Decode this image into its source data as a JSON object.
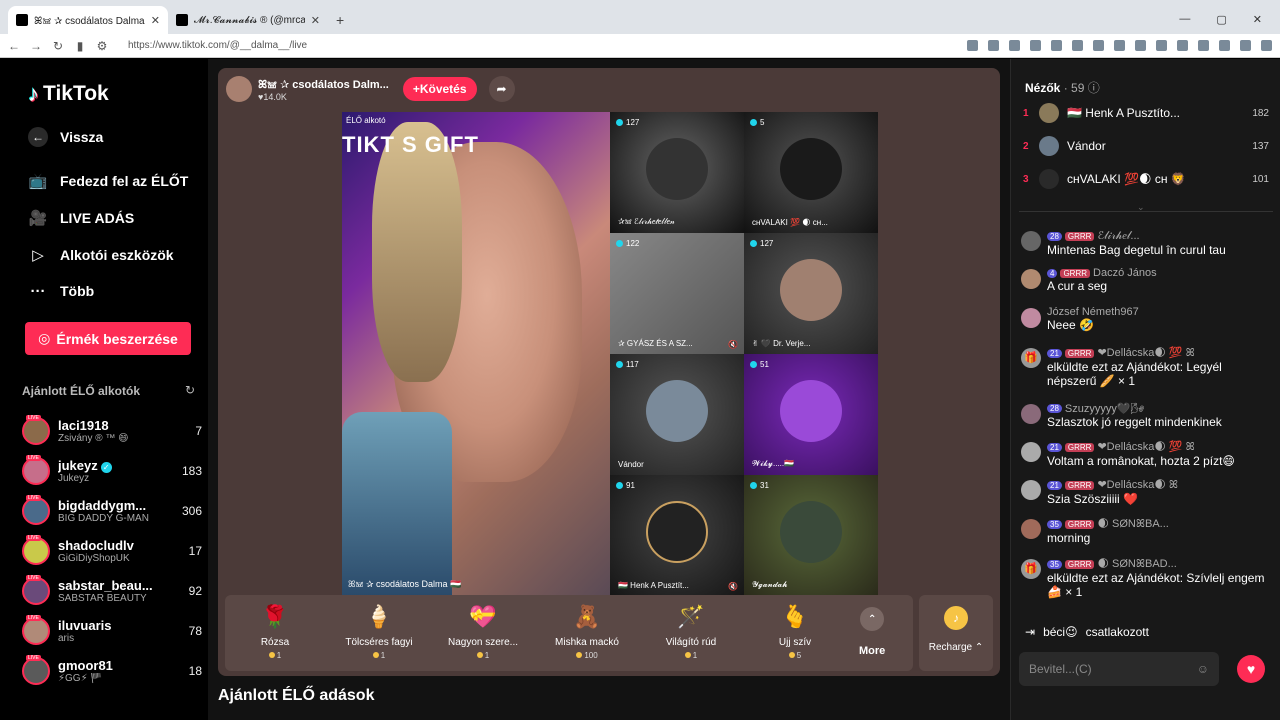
{
  "browser": {
    "tabs": [
      {
        "title": "ꕤ𖠌 ✰ csodálatos Dalma",
        "close": "✕"
      },
      {
        "title": "𝓜𝓻.𝓒𝓪𝓷𝓷𝓪𝓫𝓲𝓼 ® (@mrcannabis_)",
        "close": "✕"
      }
    ],
    "new_tab": "+",
    "url": "https://www.tiktok.com/@__dalma__/live"
  },
  "sidebar": {
    "logo": "TikTok",
    "back": "Vissza",
    "nav": [
      {
        "label": "Fedezd fel az ÉLŐT",
        "icon": "tv-icon"
      },
      {
        "label": "LIVE ADÁS",
        "icon": "camera-icon"
      },
      {
        "label": "Alkotói eszközök",
        "icon": "tools-icon"
      },
      {
        "label": "Több",
        "icon": "more-icon"
      }
    ],
    "coins_button": "Érmék beszerzése",
    "recommended_title": "Ajánlott ÉLŐ alkotók",
    "creators": [
      {
        "name": "laci1918",
        "sub": "Zsivány ® ™ 😄",
        "count": "7",
        "verified": false
      },
      {
        "name": "jukeyz",
        "sub": "Jukeyz",
        "count": "183",
        "verified": true
      },
      {
        "name": "bigdaddygm...",
        "sub": "BIG DADDY G-MAN",
        "count": "306",
        "verified": false
      },
      {
        "name": "shadocludlv",
        "sub": "GiGiDiyShopUK",
        "count": "17",
        "verified": false
      },
      {
        "name": "sabstar_beau...",
        "sub": "SABSTAR BEAUTY",
        "count": "92",
        "verified": false
      },
      {
        "name": "iluvuaris",
        "sub": "aris",
        "count": "78",
        "verified": false
      },
      {
        "name": "gmoor81",
        "sub": "⚡GG⚡ 🏴",
        "count": "18",
        "verified": false
      }
    ]
  },
  "stream": {
    "host_name": "ꕤ𖠌 ✰ csodálatos Dalm...",
    "host_likes": "♥14.0K",
    "follow": "+Követés",
    "main_label": "ÉLŐ alkotó",
    "main_banner": "TIKT S GIFT",
    "main_name": "ꕤ𖠌 ✰ csodálatos Dalma 🇭🇺",
    "guests": [
      {
        "count": "127",
        "name": "✰𖠌 ℰ𝓁𝒾𝓇𝒽𝑒𝓉𝑒𝓁𝓁𝑒𝓃"
      },
      {
        "count": "5",
        "name": "ᴄʜVALAKI 💯 🌒 ᴄʜ..."
      },
      {
        "count": "122",
        "name": "✰ GYÁSZ ÉS A SZ..."
      },
      {
        "count": "127",
        "name": "✌ 🖤 Dr. Verje..."
      },
      {
        "count": "117",
        "name": "Vándor"
      },
      {
        "count": "51",
        "name": "𝓦𝓲𝓴𝔂.....🇭🇺"
      },
      {
        "count": "91",
        "name": "🇭🇺 Henk A Pusztít..."
      },
      {
        "count": "31",
        "name": "𝓨𝓰𝓪𝓷𝓭𝓪𝓱"
      }
    ],
    "gifts": [
      {
        "name": "Rózsa",
        "price": "1",
        "emoji": "🌹"
      },
      {
        "name": "Tölcséres fagyi",
        "price": "1",
        "emoji": "🍦"
      },
      {
        "name": "Nagyon szere...",
        "price": "1",
        "emoji": "💝"
      },
      {
        "name": "Mishka mackó",
        "price": "100",
        "emoji": "🧸"
      },
      {
        "name": "Világító rúd",
        "price": "1",
        "emoji": "🪄"
      },
      {
        "name": "Ujj szív",
        "price": "5",
        "emoji": "🫰"
      }
    ],
    "more": "More",
    "recharge": "Recharge ⌃",
    "recommended_lives": "Ajánlott ÉLŐ adások"
  },
  "chat": {
    "viewers_label": "Nézők",
    "viewers_count": "· 59",
    "top_viewers": [
      {
        "rank": "1",
        "name": "🇭🇺 Henk A Pusztíto...",
        "score": "182"
      },
      {
        "rank": "2",
        "name": "Vándor",
        "score": "137"
      },
      {
        "rank": "3",
        "name": "ᴄʜVALAKI 💯🌒 ᴄʜ 🦁",
        "score": "101"
      }
    ],
    "messages": [
      {
        "level": "28",
        "fan": "GRRR",
        "user": "ℰ𝓁𝒾𝓇𝒽𝑒𝓁...",
        "text": "Mintenas Bag degetul în curul tau",
        "gift": false
      },
      {
        "level": "4",
        "fan": "GRRR",
        "user": "Daczó János",
        "text": "A cur a seg",
        "gift": false
      },
      {
        "level": "",
        "fan": "",
        "user": "József Németh967",
        "text": "Neee 🤣",
        "gift": false
      },
      {
        "level": "21",
        "fan": "GRRR",
        "user": "❤Dellácska🌒 💯 ꕤ",
        "text": "elküldte ezt az Ajándékot: Legyél népszerű 🥖 × 1",
        "gift": true
      },
      {
        "level": "28",
        "fan": "",
        "user": "Szuzyyyyy🖤🌬",
        "text": "Szlasztok jó reggelt mindenkinek",
        "gift": false
      },
      {
        "level": "21",
        "fan": "GRRR",
        "user": "❤Dellácska🌒 💯 ꕤ",
        "text": "Voltam a românokat, hozta 2 pízt😄",
        "gift": false
      },
      {
        "level": "21",
        "fan": "GRRR",
        "user": "❤Dellácska🌒 ꕤ",
        "text": "Szia Szösziiiii ❤️",
        "gift": false
      },
      {
        "level": "35",
        "fan": "GRRR",
        "user": "🌒 SØNꕤBA...",
        "text": "morning",
        "gift": false
      },
      {
        "level": "35",
        "fan": "GRRR",
        "user": "🌒 SØNꕤBAD...",
        "text": "elküldte ezt az Ajándékot: Szívlelj engem 🍰 × 1",
        "gift": true
      }
    ],
    "joined_user": "béci😉",
    "joined_text": "csatlakozott",
    "input_placeholder": "Bevitel...(C)",
    "colors": {
      "accent": "#fe2c55",
      "level_badge": "#5a55d6",
      "fan_badge": "#c43e55"
    }
  }
}
